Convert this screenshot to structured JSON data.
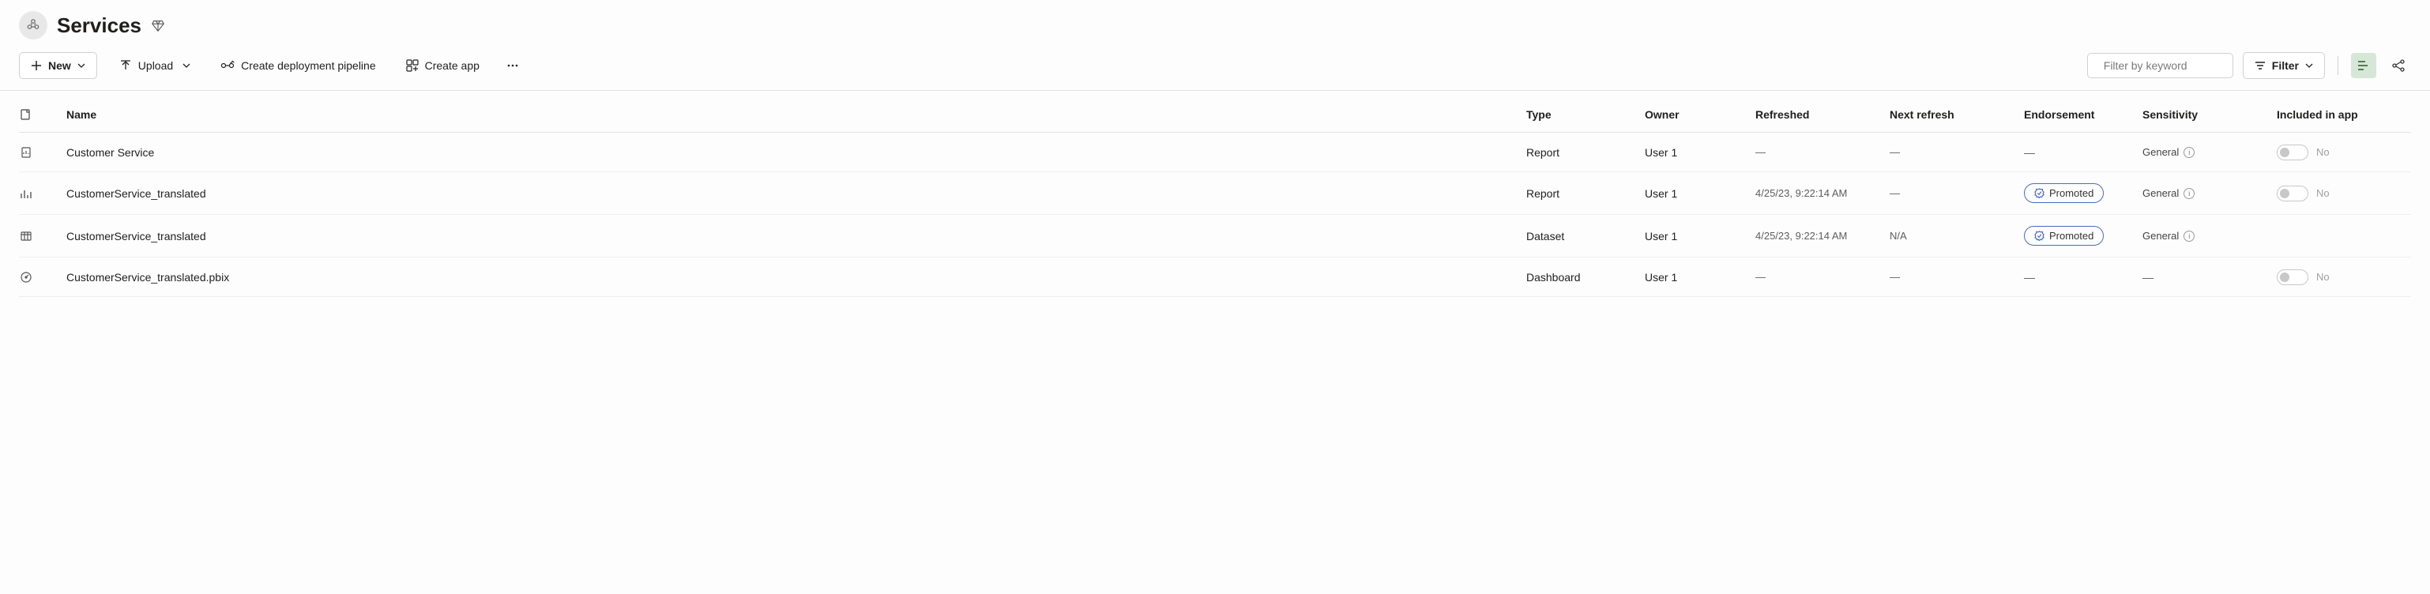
{
  "header": {
    "title": "Services"
  },
  "toolbar": {
    "new_label": "New",
    "upload_label": "Upload",
    "pipeline_label": "Create deployment pipeline",
    "create_app_label": "Create app",
    "search_placeholder": "Filter by keyword",
    "filter_label": "Filter"
  },
  "columns": {
    "name": "Name",
    "type": "Type",
    "owner": "Owner",
    "refreshed": "Refreshed",
    "next_refresh": "Next refresh",
    "endorsement": "Endorsement",
    "sensitivity": "Sensitivity",
    "included": "Included in app"
  },
  "rows": [
    {
      "icon": "report",
      "name": "Customer Service",
      "type": "Report",
      "owner": "User 1",
      "refreshed": "—",
      "next_refresh": "—",
      "endorsement": "—",
      "endorsement_pill": false,
      "sensitivity": "General",
      "sensitivity_info": true,
      "included_toggle": true,
      "included_label": "No"
    },
    {
      "icon": "report-bar",
      "name": "CustomerService_translated",
      "type": "Report",
      "owner": "User 1",
      "refreshed": "4/25/23, 9:22:14 AM",
      "next_refresh": "—",
      "endorsement": "Promoted",
      "endorsement_pill": true,
      "sensitivity": "General",
      "sensitivity_info": true,
      "included_toggle": true,
      "included_label": "No"
    },
    {
      "icon": "dataset",
      "name": "CustomerService_translated",
      "type": "Dataset",
      "owner": "User 1",
      "refreshed": "4/25/23, 9:22:14 AM",
      "next_refresh": "N/A",
      "endorsement": "Promoted",
      "endorsement_pill": true,
      "sensitivity": "General",
      "sensitivity_info": true,
      "included_toggle": false,
      "included_label": ""
    },
    {
      "icon": "dashboard",
      "name": "CustomerService_translated.pbix",
      "type": "Dashboard",
      "owner": "User 1",
      "refreshed": "—",
      "next_refresh": "—",
      "endorsement": "—",
      "endorsement_pill": false,
      "sensitivity": "—",
      "sensitivity_info": false,
      "included_toggle": true,
      "included_label": "No"
    }
  ]
}
